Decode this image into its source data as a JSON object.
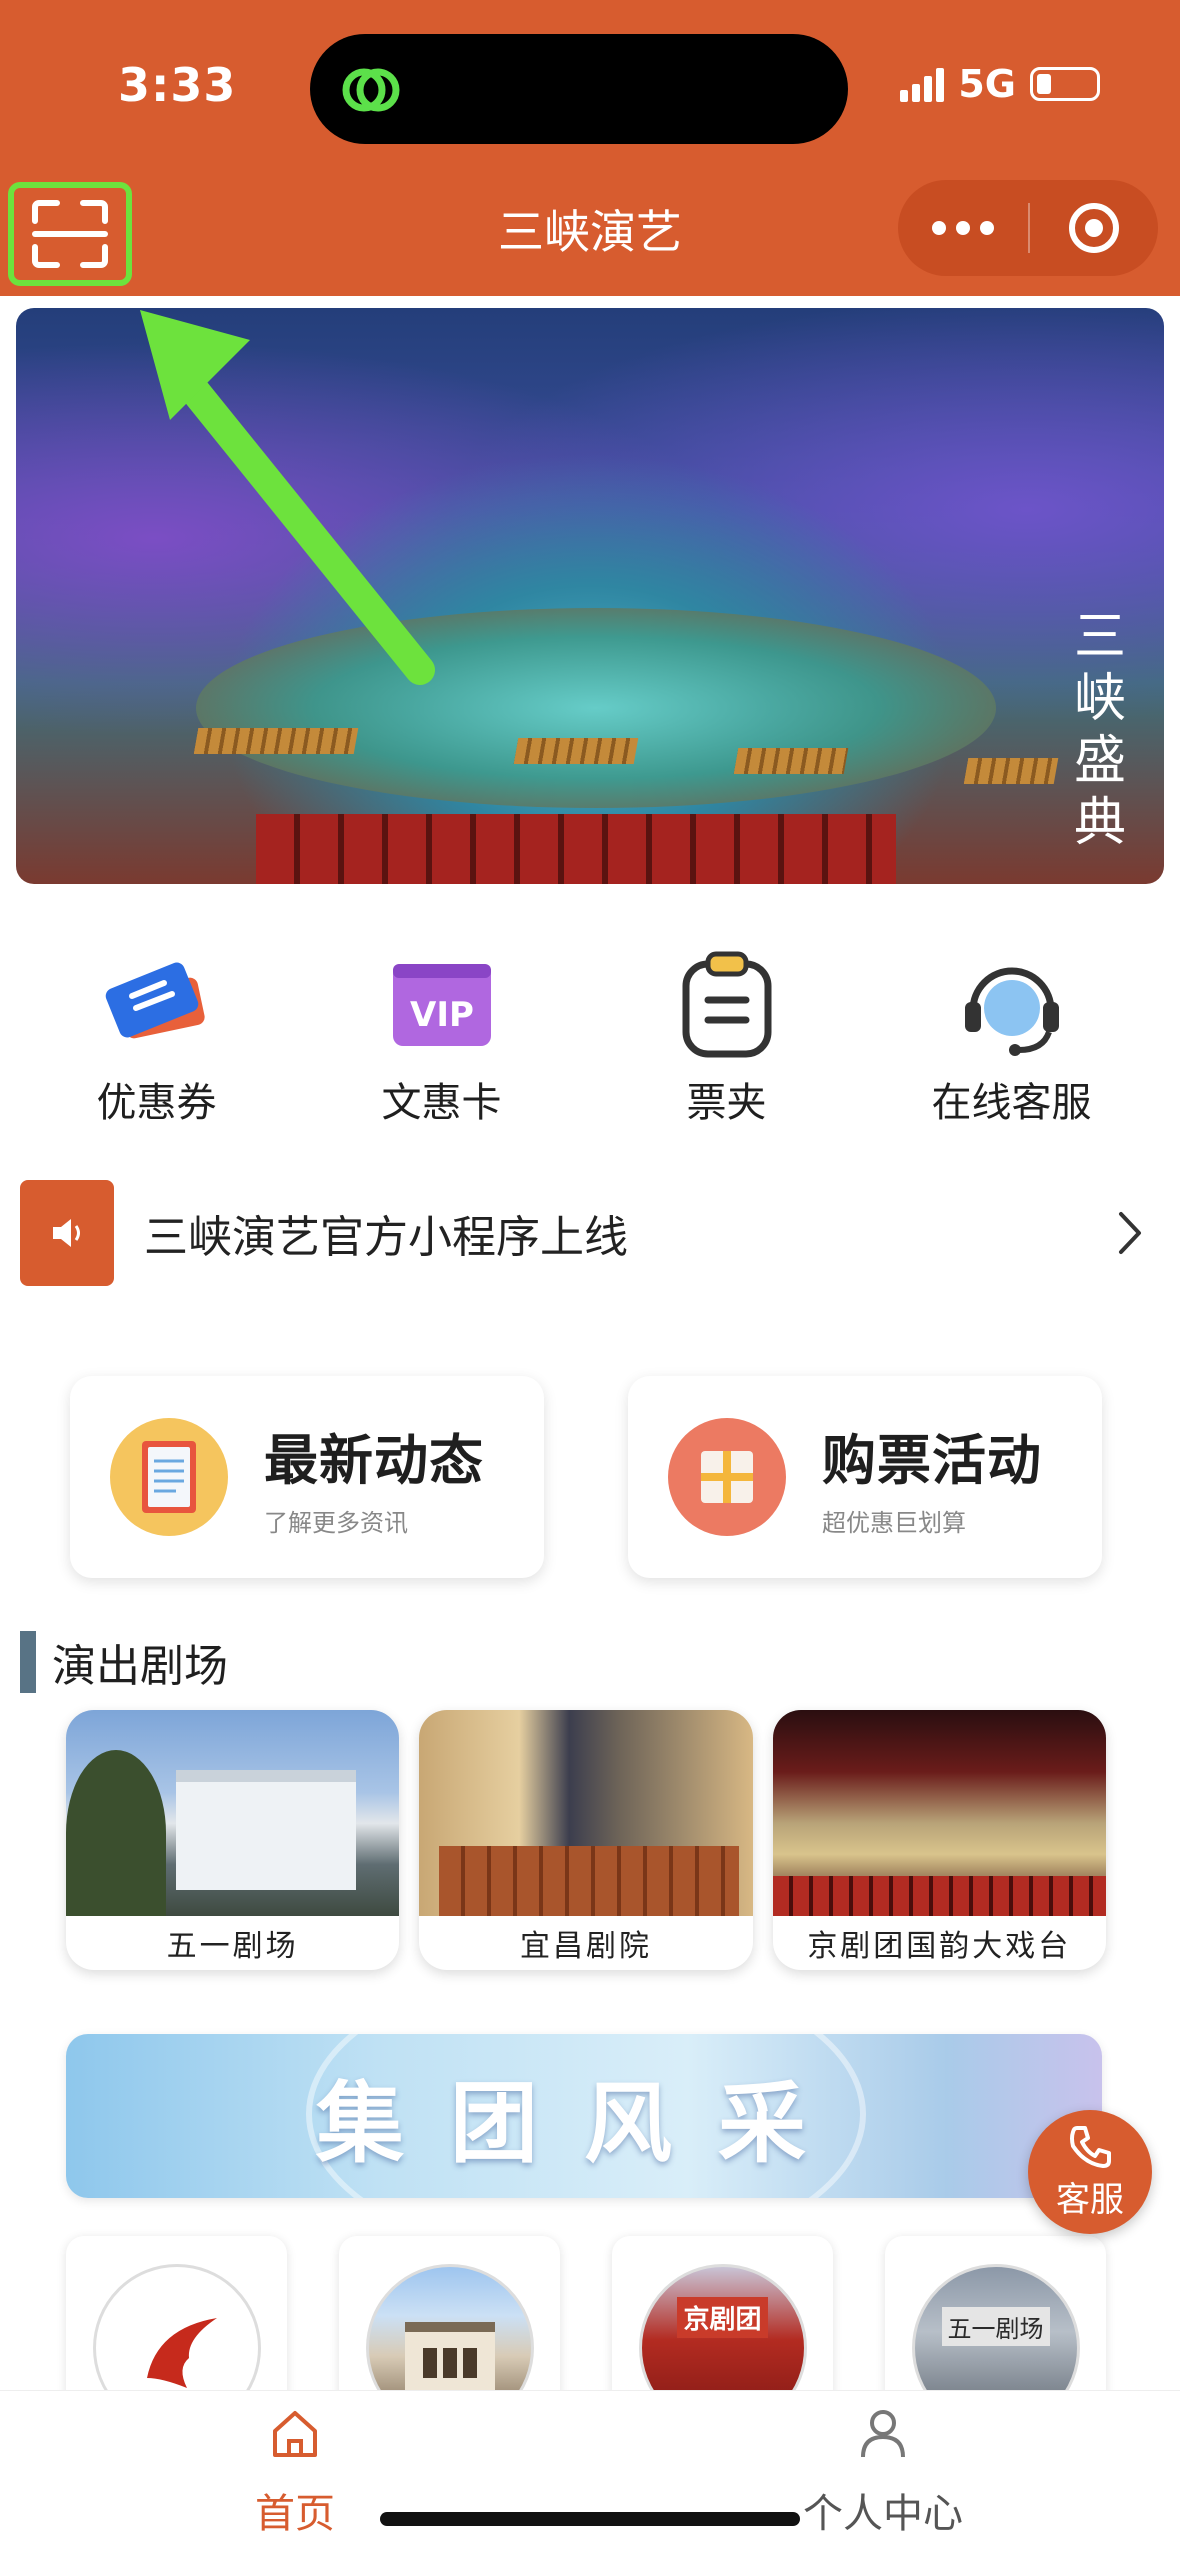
{
  "status_bar": {
    "time": "3:33",
    "network": "5G"
  },
  "nav": {
    "title": "三峡演艺"
  },
  "banner": {
    "logo_text": "三峡盛典"
  },
  "quick_menu": [
    {
      "label": "优惠券",
      "icon": "coupon-icon"
    },
    {
      "label": "文惠卡",
      "icon": "vip-card-icon"
    },
    {
      "label": "票夹",
      "icon": "ticket-folder-icon"
    },
    {
      "label": "在线客服",
      "icon": "customer-service-icon"
    }
  ],
  "notice": {
    "text": "三峡演艺官方小程序上线"
  },
  "features": [
    {
      "title": "最新动态",
      "subtitle": "了解更多资讯",
      "icon": "document-icon"
    },
    {
      "title": "购票活动",
      "subtitle": "超优惠巨划算",
      "icon": "gift-icon"
    }
  ],
  "theatres": {
    "section_title": "演出剧场",
    "items": [
      {
        "label": "五一剧场"
      },
      {
        "label": "宜昌剧院"
      },
      {
        "label": "京剧团国韵大戏台"
      }
    ]
  },
  "group": {
    "banner_title": "集团风采"
  },
  "members": [
    {
      "icon": "brand-logo-icon"
    },
    {
      "icon": "building-icon"
    },
    {
      "sign": "京剧团"
    },
    {
      "sign": "五一剧场"
    }
  ],
  "float_button": {
    "label": "客服"
  },
  "tabbar": [
    {
      "label": "首页",
      "icon": "home-icon"
    },
    {
      "label": "个人中心",
      "icon": "user-icon"
    }
  ],
  "colors": {
    "brand": "#d75c2f",
    "highlight": "#6de23d"
  }
}
